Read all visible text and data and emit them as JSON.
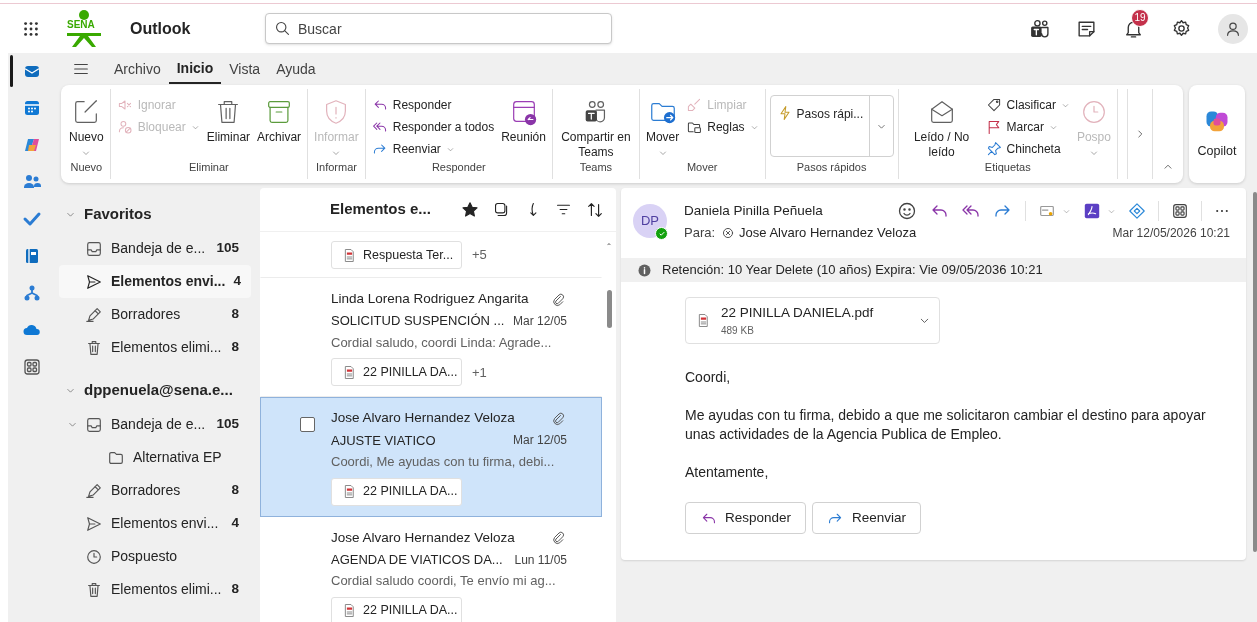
{
  "top_bar": {
    "logo_text": "SENA",
    "app_name": "Outlook",
    "search": {
      "placeholder": "Buscar"
    },
    "notification_count": "19"
  },
  "menu_tabs": [
    {
      "label": "Archivo",
      "selected": false
    },
    {
      "label": "Inicio",
      "selected": true
    },
    {
      "label": "Vista",
      "selected": false
    },
    {
      "label": "Ayuda",
      "selected": false
    }
  ],
  "ribbon": {
    "groups": [
      {
        "label": "Nuevo",
        "items": [
          {
            "kind": "large",
            "label": "Nuevo",
            "disabled": false,
            "dropdown": true
          }
        ]
      },
      {
        "label": "Eliminar",
        "items": [
          {
            "kind": "small",
            "label": "Ignorar",
            "disabled": true,
            "dropdown": false
          },
          {
            "kind": "small",
            "label": "Bloquear",
            "disabled": true,
            "dropdown": true
          },
          {
            "kind": "large",
            "label": "Eliminar",
            "disabled": false,
            "dropdown": false
          },
          {
            "kind": "large",
            "label": "Archivar",
            "disabled": false,
            "dropdown": false
          }
        ]
      },
      {
        "label": "Informar",
        "items": [
          {
            "kind": "large",
            "label": "Informar",
            "disabled": true,
            "dropdown": true
          }
        ]
      },
      {
        "label": "Responder",
        "items": [
          {
            "kind": "small",
            "label": "Responder",
            "disabled": false,
            "dropdown": false
          },
          {
            "kind": "small",
            "label": "Responder a todos",
            "disabled": false,
            "dropdown": false
          },
          {
            "kind": "small",
            "label": "Reenviar",
            "disabled": false,
            "dropdown": true
          },
          {
            "kind": "large",
            "label": "Reunión",
            "disabled": false,
            "dropdown": false
          }
        ]
      },
      {
        "label": "Teams",
        "items": [
          {
            "kind": "large",
            "label": "Compartir en Teams",
            "disabled": false,
            "dropdown": false
          }
        ]
      },
      {
        "label": "Mover",
        "items": [
          {
            "kind": "large",
            "label": "Mover",
            "disabled": false,
            "dropdown": true
          },
          {
            "kind": "small",
            "label": "Limpiar",
            "disabled": true,
            "dropdown": false
          },
          {
            "kind": "small",
            "label": "Reglas",
            "disabled": false,
            "dropdown": true
          }
        ]
      },
      {
        "label": "Pasos rápidos",
        "items": [
          {
            "kind": "quick",
            "label": "Pasos rápi...",
            "dropdown": true
          }
        ]
      },
      {
        "label": "Etiquetas",
        "items": [
          {
            "kind": "large",
            "label": "Leído / No leído",
            "disabled": false,
            "dropdown": false
          },
          {
            "kind": "small",
            "label": "Clasificar",
            "disabled": false,
            "dropdown": true
          },
          {
            "kind": "small",
            "label": "Marcar",
            "disabled": false,
            "dropdown": true
          },
          {
            "kind": "small",
            "label": "Chincheta",
            "disabled": false,
            "dropdown": false
          },
          {
            "kind": "large",
            "label": "Pospo",
            "disabled": true,
            "dropdown": true
          }
        ]
      }
    ],
    "copilot": "Copilot"
  },
  "folders": {
    "sections": [
      {
        "label": "Favoritos",
        "expanded": true,
        "items": [
          {
            "kind": "inbox",
            "label": "Bandeja de e...",
            "count": "105",
            "selected": false
          },
          {
            "kind": "sent",
            "label": "Elementos envi...",
            "count": "4",
            "selected": true
          },
          {
            "kind": "drafts",
            "label": "Borradores",
            "count": "8",
            "selected": false
          },
          {
            "kind": "deleted",
            "label": "Elementos elimi...",
            "count": "8",
            "selected": false
          }
        ]
      },
      {
        "label": "dppenuela@sena.e...",
        "expanded": true,
        "items": [
          {
            "kind": "inbox",
            "label": "Bandeja de e...",
            "count": "105",
            "selected": false,
            "expanded": true,
            "children": [
              {
                "kind": "folder",
                "label": "Alternativa EP",
                "selected": false
              }
            ]
          },
          {
            "kind": "drafts",
            "label": "Borradores",
            "count": "8",
            "selected": false
          },
          {
            "kind": "sent",
            "label": "Elementos envi...",
            "count": "4",
            "selected": false
          },
          {
            "kind": "snoozed",
            "label": "Pospuesto",
            "selected": false
          },
          {
            "kind": "deleted",
            "label": "Elementos elimi...",
            "count": "8",
            "selected": false
          }
        ]
      }
    ]
  },
  "mail_list": {
    "title": "Elementos e...",
    "messages": [
      {
        "attachments": [
          "Respuesta Ter..."
        ],
        "more_attachments": "+5",
        "selected": false
      },
      {
        "sender": "Linda Lorena Rodriguez Angarita",
        "subject": "SOLICITUD SUSPENCIÓN ...",
        "date": "Mar 12/05",
        "preview": "Cordial saludo, coordi Linda: Agrade...",
        "attachments": [
          "22 PINILLA DA..."
        ],
        "more_attachments": "+1",
        "selected": false
      },
      {
        "sender": "Jose Alvaro Hernandez Veloza",
        "subject": "AJUSTE VIATICO",
        "date": "Mar 12/05",
        "preview": "Coordi, Me ayudas con tu firma, debi...",
        "attachments": [
          "22 PINILLA DA..."
        ],
        "selected": true
      },
      {
        "sender": "Jose Alvaro Hernandez Veloza",
        "subject": "AGENDA DE VIATICOS DA...",
        "date": "Lun 11/05",
        "preview": "Cordial saludo coordi, Te envío mi ag...",
        "attachments": [
          "22 PINILLA DA..."
        ],
        "selected": false
      }
    ]
  },
  "reading_pane": {
    "sender": "Daniela Pinilla Peñuela",
    "initials": "DP",
    "to_label": "Para:",
    "recipient": "Jose Alvaro Hernandez Veloza",
    "date": "Mar 12/05/2026 10:21",
    "retention": "Retención: 10 Year Delete (10 años) Expira: Vie 09/05/2036 10:21",
    "attachment": {
      "name": "22 PINILLA DANIELA.pdf",
      "size": "489 KB"
    },
    "body": [
      "Coordi,",
      "Me ayudas con tu firma, debido a que me solicitaron cambiar el destino para apoyar unas actividades de la Agencia Publica de Empleo.",
      "Atentamente,"
    ],
    "actions": [
      "Responder",
      "Reenviar"
    ]
  }
}
